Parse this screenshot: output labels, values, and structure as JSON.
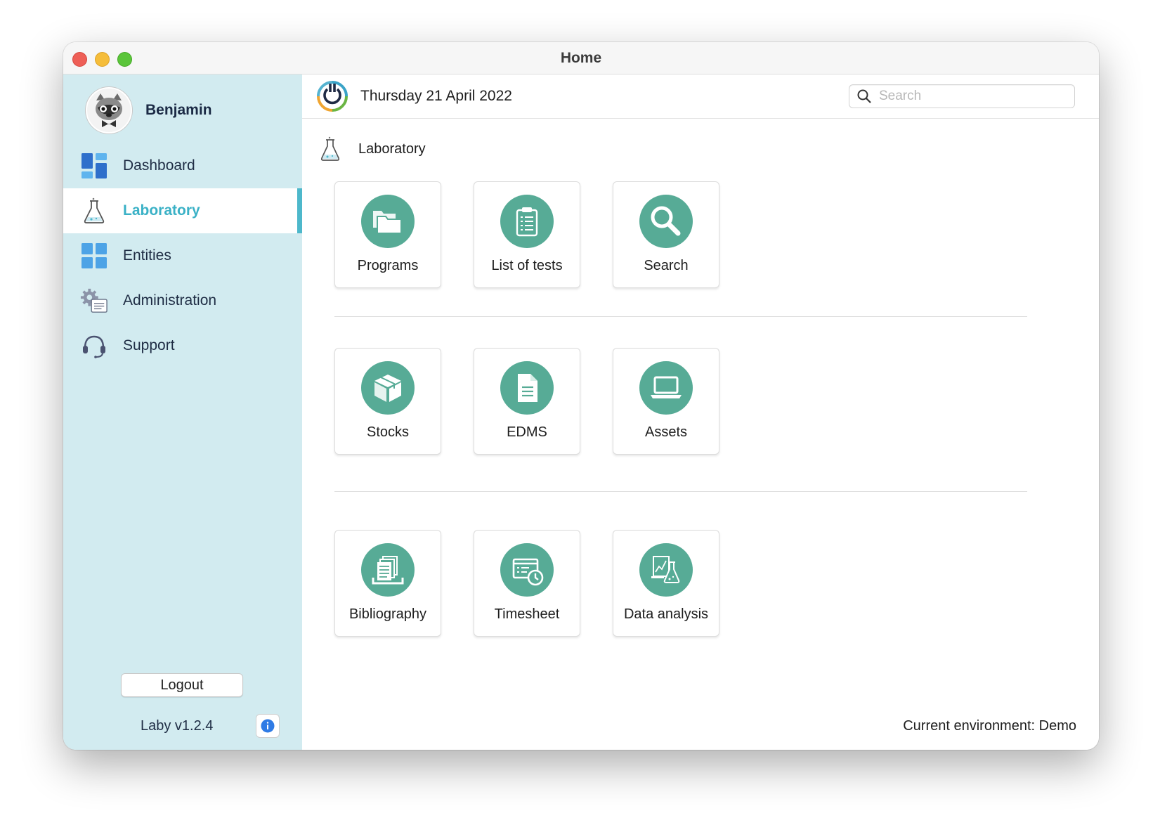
{
  "window": {
    "title": "Home"
  },
  "sidebar": {
    "user": {
      "name": "Benjamin"
    },
    "items": [
      {
        "label": "Dashboard",
        "icon": "dashboard-icon"
      },
      {
        "label": "Laboratory",
        "icon": "flask-icon",
        "active": true
      },
      {
        "label": "Entities",
        "icon": "grid-icon"
      },
      {
        "label": "Administration",
        "icon": "gear-document-icon"
      },
      {
        "label": "Support",
        "icon": "headset-icon"
      }
    ],
    "logout_label": "Logout",
    "version": "Laby v1.2.4"
  },
  "header": {
    "date": "Thursday 21 April 2022",
    "search_placeholder": "Search"
  },
  "main": {
    "section_title": "Laboratory",
    "tiles": [
      {
        "label": "Programs",
        "icon": "folders-icon"
      },
      {
        "label": "List of tests",
        "icon": "clipboard-list-icon"
      },
      {
        "label": "Search",
        "icon": "magnifier-icon"
      },
      {
        "label": "Stocks",
        "icon": "box-icon"
      },
      {
        "label": "EDMS",
        "icon": "document-icon"
      },
      {
        "label": "Assets",
        "icon": "laptop-icon"
      },
      {
        "label": "Bibliography",
        "icon": "papers-stack-icon"
      },
      {
        "label": "Timesheet",
        "icon": "calendar-clock-icon"
      },
      {
        "label": "Data analysis",
        "icon": "chart-flask-icon"
      }
    ]
  },
  "footer": {
    "environment": "Current environment: Demo"
  },
  "colors": {
    "sidebar_bg": "#d2ebf0",
    "accent": "#3ab1c6",
    "tile_icon_bg": "#57ab96"
  }
}
